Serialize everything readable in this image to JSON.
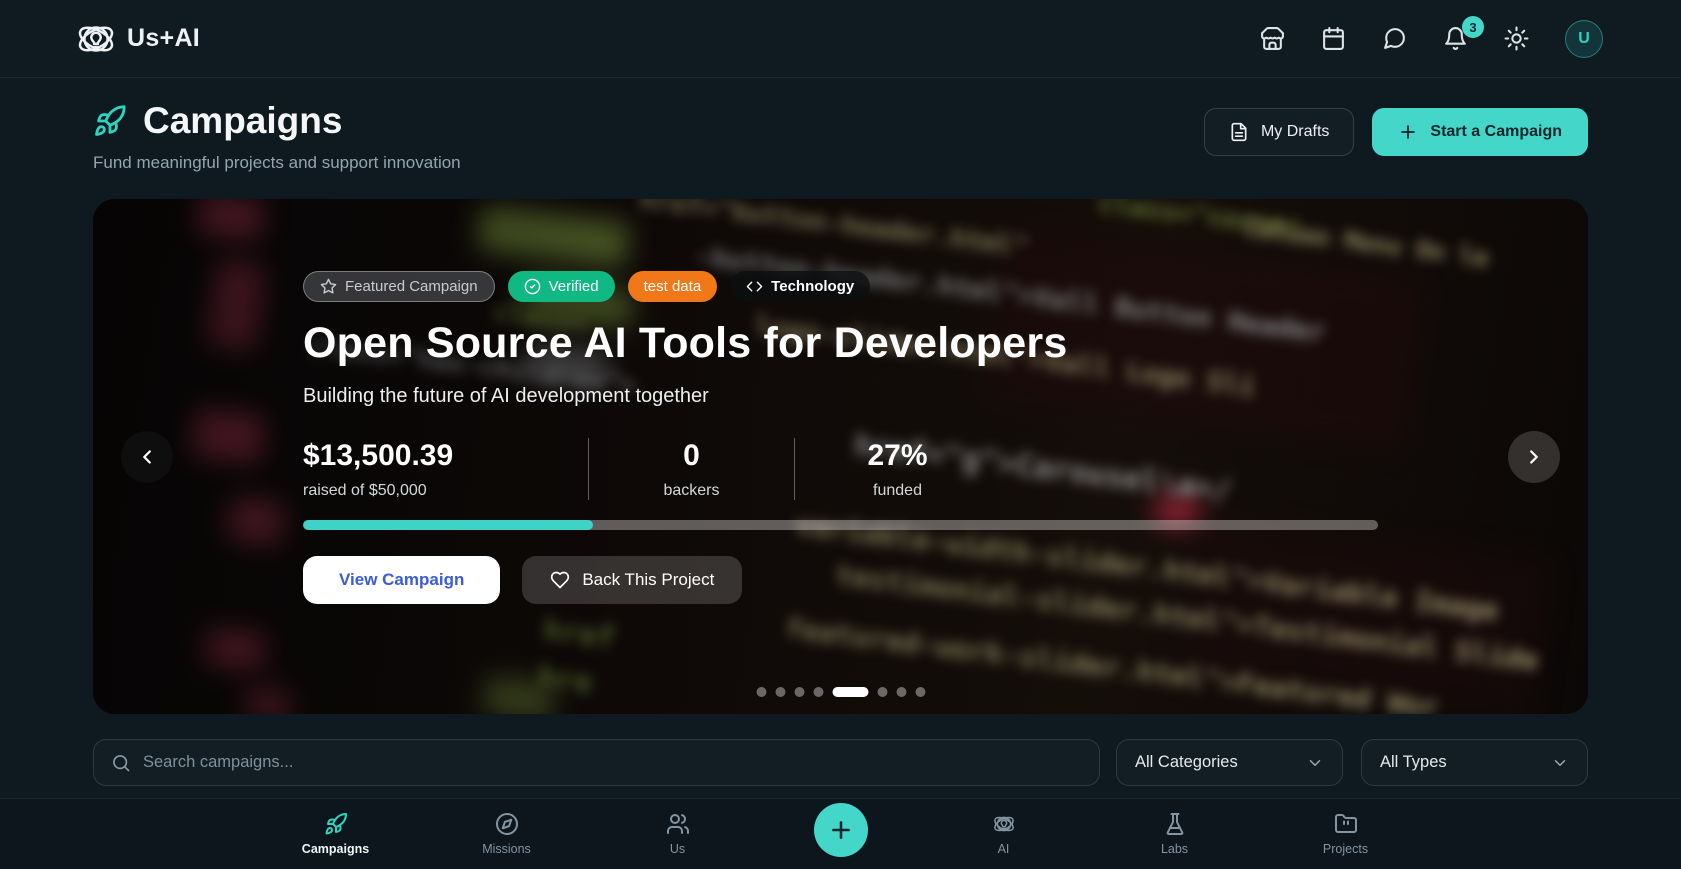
{
  "topbar": {
    "logo_text": "Us+AI",
    "notification_count": "3",
    "avatar_initial": "U"
  },
  "header": {
    "title": "Campaigns",
    "subtitle": "Fund meaningful projects and support innovation",
    "drafts_label": "My Drafts",
    "start_label": "Start a Campaign"
  },
  "hero": {
    "badges": {
      "featured": "Featured Campaign",
      "verified": "Verified",
      "tag": "test data",
      "category": "Technology"
    },
    "title": "Open Source AI Tools for Developers",
    "subtitle": "Building the future of AI development together",
    "stats": [
      {
        "value": "$13,500.39",
        "label": "raised of $50,000"
      },
      {
        "value": "0",
        "label": "backers"
      },
      {
        "value": "27%",
        "label": "funded"
      }
    ],
    "progress_percent": 27,
    "view_label": "View Campaign",
    "back_label": "Back This Project",
    "carousel": {
      "slide_count": 8,
      "active_slide": 5
    },
    "background_code_fragments": [
      "href=\"button-header.html\"",
      "class=\"corner",
      "Column Menu On la",
      "-button-header.html\">Vall Button Header",
      "logo-slider.html\">Vall Logo Sli",
      "class=\"has-children\">",
      "href=\"g\">Carousel\\a>/",
      "variable-width-slider.html\">Variable Image",
      "testimonial-slider.html\">Testimonial Slide",
      "featured-work-slider.html\">Featured Wor",
      "href",
      "hre",
      "class="
    ]
  },
  "filters": {
    "search_placeholder": "Search campaigns...",
    "category_label": "All Categories",
    "type_label": "All Types"
  },
  "bottom_nav": {
    "plus_label": "+",
    "items": [
      {
        "label": "Campaigns",
        "active": true
      },
      {
        "label": "Missions",
        "active": false
      },
      {
        "label": "Us",
        "active": false
      },
      {
        "label": "AI",
        "active": false
      },
      {
        "label": "Labs",
        "active": false
      },
      {
        "label": "Projects",
        "active": false
      }
    ]
  },
  "colors": {
    "accent_teal": "#45d6ca",
    "icon_teal": "#2dd4bf",
    "verified_green": "#10b981",
    "tag_orange": "#f07818",
    "link_blue": "#3b5bdb",
    "page_background": "#0e1a20"
  }
}
